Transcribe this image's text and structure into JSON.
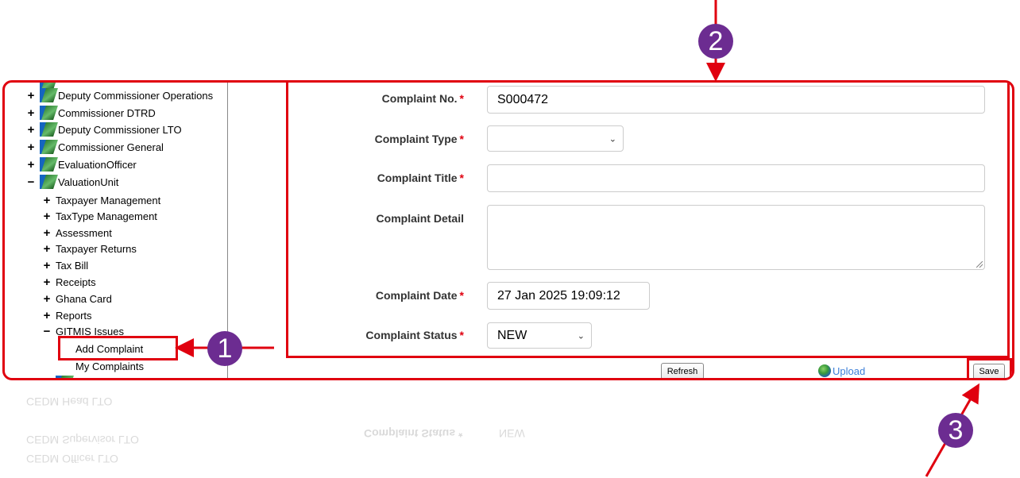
{
  "tree": {
    "top_partial": "...",
    "items": [
      {
        "toggle": "+",
        "label": "Deputy Commissioner Operations"
      },
      {
        "toggle": "+",
        "label": "Commissioner DTRD"
      },
      {
        "toggle": "+",
        "label": "Deputy Commissioner LTO"
      },
      {
        "toggle": "+",
        "label": "Commissioner General"
      },
      {
        "toggle": "+",
        "label": "EvaluationOfficer"
      },
      {
        "toggle": "−",
        "label": "ValuationUnit"
      }
    ],
    "sub_items": [
      {
        "toggle": "+",
        "label": "Taxpayer Management"
      },
      {
        "toggle": "+",
        "label": "TaxType Management"
      },
      {
        "toggle": "+",
        "label": "Assessment"
      },
      {
        "toggle": "+",
        "label": "Taxpayer Returns"
      },
      {
        "toggle": "+",
        "label": "Tax Bill"
      },
      {
        "toggle": "+",
        "label": "Receipts"
      },
      {
        "toggle": "+",
        "label": "Ghana Card"
      },
      {
        "toggle": "+",
        "label": "Reports"
      },
      {
        "toggle": "−",
        "label": "GITMIS Issues"
      }
    ],
    "leaf_items": [
      "Add Complaint",
      "My Complaints"
    ]
  },
  "form": {
    "complaint_no": {
      "label": "Complaint No.",
      "required": "*",
      "value": "S000472"
    },
    "complaint_type": {
      "label": "Complaint Type",
      "required": "*",
      "value": ""
    },
    "complaint_title": {
      "label": "Complaint Title",
      "required": "*",
      "value": ""
    },
    "complaint_detail": {
      "label": "Complaint Detail",
      "value": ""
    },
    "complaint_date": {
      "label": "Complaint Date",
      "required": "*",
      "value": "27 Jan 2025 19:09:12"
    },
    "complaint_status": {
      "label": "Complaint Status",
      "required": "*",
      "value": "NEW"
    }
  },
  "actions": {
    "refresh": "Refresh",
    "upload": "Upload",
    "save": "Save"
  },
  "callouts": {
    "one": "1",
    "two": "2",
    "three": "3"
  },
  "reflection": {
    "items": [
      "CEDM Head LTO",
      "CEDM Supervisor LTO",
      "CEDM Officer LTO"
    ],
    "status_label": "Complaint Status *",
    "status_value": "NEW"
  },
  "colors": {
    "highlight": "#e0000f",
    "badge": "#6c2c91",
    "upload_link": "#3c7fd8"
  }
}
